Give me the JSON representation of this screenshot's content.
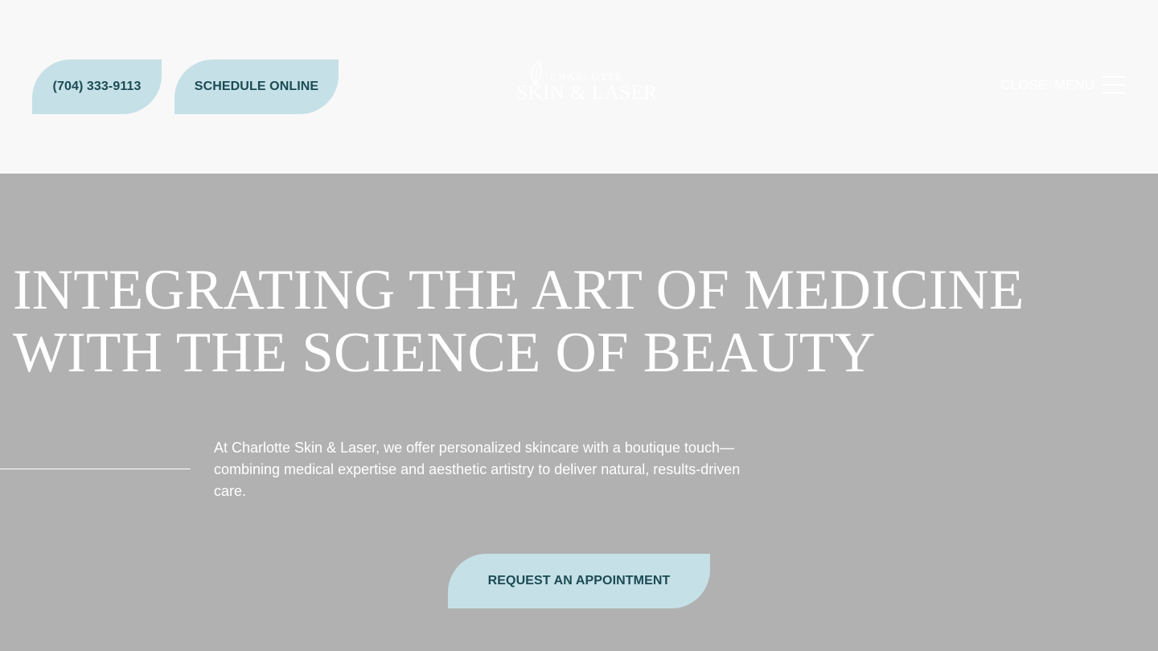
{
  "header": {
    "phone_label": "(704) 333-9113",
    "schedule_label": "SCHEDULE ONLINE",
    "logo": {
      "top_text": "CHARLOTTE",
      "bottom_text": "SKIN & LASER"
    },
    "close_label": "CLOSE",
    "menu_label": "MENU"
  },
  "hero": {
    "title_line1": "INTEGRATING THE ART OF MEDICINE",
    "title_line2": "WITH THE SCIENCE OF BEAUTY",
    "description": "At Charlotte Skin & Laser, we offer personalized skincare with a boutique touch—combining medical expertise and aesthetic artistry to deliver natural, results-driven care.",
    "cta_label": "REQUEST AN APPOINTMENT"
  },
  "colors": {
    "header_bg": "#f8f8f8",
    "hero_bg": "#b1b1b1",
    "button_bg": "#c5e1e7",
    "button_text": "#1c4a52",
    "text_light": "#ffffff"
  },
  "icons": {
    "logo_mark": "leaf-icon",
    "menu": "hamburger-icon"
  }
}
